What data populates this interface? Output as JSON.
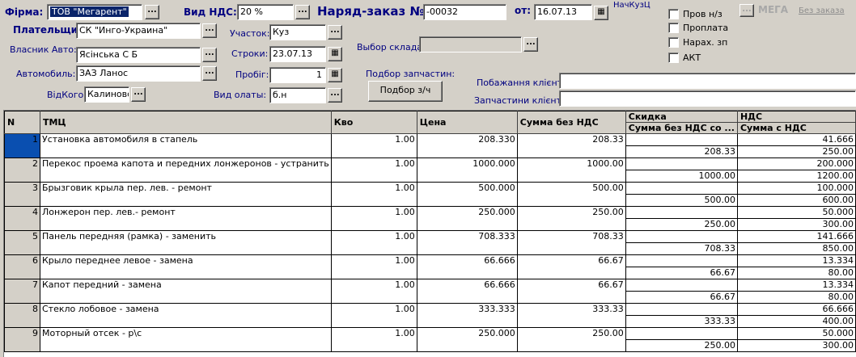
{
  "header": {
    "firm_label": "Фірма:",
    "firm_value": "ТОВ \"Мегарент\"",
    "vat_type_label": "Вид НДС:",
    "vat_type_value": "20 %",
    "order_label": "Наряд-заказ №:",
    "order_number": "-00032",
    "date_label": "от:",
    "date_value": "16.07.13",
    "nachkuzc_label": "НачКузЦ",
    "payer_label": "Плательщик:",
    "payer_value": "СК \"Инго-Украина\"",
    "section_label": "Участок:",
    "section_value": "Куз",
    "warehouse_label": "Выбор склада:",
    "warehouse_value": "",
    "owner_label": "Власник Авто:",
    "owner_value": "Ясінська С Б",
    "deadline_label": "Строки:",
    "deadline_value": "23.07.13",
    "car_label": "Автомобиль:",
    "car_value": "ЗАЗ Ланос",
    "mileage_label": "Пробіг:",
    "mileage_value": "1",
    "parts_pick_label": "Подбор запчастин:",
    "parts_pick_button": "Подбор з/ч",
    "from_whom_label": "ВідКого:",
    "from_whom_value": "Калиновс",
    "payment_label": "Вид олаты:",
    "payment_value": "б.н",
    "client_wish_label": "Побажання клієнта:",
    "client_wish_value": "",
    "client_parts_label": "Запчастини клієнта:",
    "client_parts_value": "",
    "ellipsis": "...",
    "calendar_glyph": "▦"
  },
  "checkboxes": [
    {
      "label": "Пров н/з"
    },
    {
      "label": "Проплата"
    },
    {
      "label": "Нарах. зп"
    },
    {
      "label": "АКТ"
    }
  ],
  "top_right": {
    "logo": "МЕГА",
    "no_order_link": "Без заказа"
  },
  "grid": {
    "columns": {
      "n": "N",
      "tmc": "ТМЦ",
      "qty": "Кво",
      "price": "Цена",
      "sum_no_vat": "Сумма без НДС",
      "discount": "Скидка",
      "discount_sub": "Сумма без НДС со ...",
      "vat": "НДС",
      "vat_sub": "Сумма с НДС"
    },
    "rows": [
      {
        "n": "1",
        "name": "Установка автомобиля в стапель",
        "qty": "1.00",
        "price": "208.330",
        "sum": "208.33",
        "disc_sum": "208.33",
        "vat": "41.666",
        "total": "250.00"
      },
      {
        "n": "2",
        "name": "Перекос проема капота и передних лонжеронов - устранить",
        "qty": "1.00",
        "price": "1000.000",
        "sum": "1000.00",
        "disc_sum": "1000.00",
        "vat": "200.000",
        "total": "1200.00"
      },
      {
        "n": "3",
        "name": "Брызговик крыла пер. лев. - ремонт",
        "qty": "1.00",
        "price": "500.000",
        "sum": "500.00",
        "disc_sum": "500.00",
        "vat": "100.000",
        "total": "600.00"
      },
      {
        "n": "4",
        "name": "Лонжерон пер. лев.- ремонт",
        "qty": "1.00",
        "price": "250.000",
        "sum": "250.00",
        "disc_sum": "250.00",
        "vat": "50.000",
        "total": "300.00"
      },
      {
        "n": "5",
        "name": "Панель передняя (рамка) - заменить",
        "qty": "1.00",
        "price": "708.333",
        "sum": "708.33",
        "disc_sum": "708.33",
        "vat": "141.666",
        "total": "850.00"
      },
      {
        "n": "6",
        "name": "Крыло переднее левое - замена",
        "qty": "1.00",
        "price": "66.666",
        "sum": "66.67",
        "disc_sum": "66.67",
        "vat": "13.334",
        "total": "80.00"
      },
      {
        "n": "7",
        "name": "Капот передний - замена",
        "qty": "1.00",
        "price": "66.666",
        "sum": "66.67",
        "disc_sum": "66.67",
        "vat": "13.334",
        "total": "80.00"
      },
      {
        "n": "8",
        "name": "Стекло лобовое - замена",
        "qty": "1.00",
        "price": "333.333",
        "sum": "333.33",
        "disc_sum": "333.33",
        "vat": "66.666",
        "total": "400.00"
      },
      {
        "n": "9",
        "name": "Моторный отсек - р\\с",
        "qty": "1.00",
        "price": "250.000",
        "sum": "250.00",
        "disc_sum": "250.00",
        "vat": "50.000",
        "total": "300.00"
      }
    ]
  },
  "colors": {
    "background": "#d4d0c8",
    "label_blue": "#000080",
    "selection": "#0a246a",
    "current_row": "#0a4fb0"
  }
}
